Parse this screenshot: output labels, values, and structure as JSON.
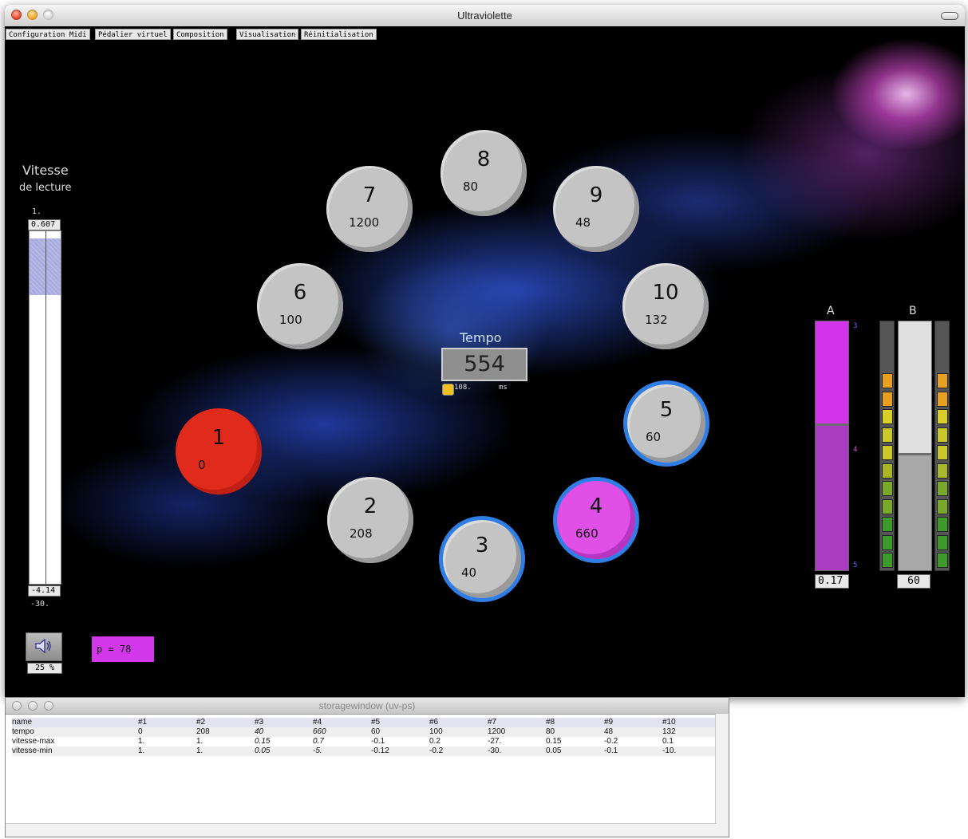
{
  "window": {
    "title": "Ultraviolette"
  },
  "menu": [
    "Configuration Midi",
    "Pédalier virtuel",
    "Composition",
    "Visualisation",
    "Réinitialisation"
  ],
  "vitesse": {
    "title": "Vitesse",
    "subtitle": "de lecture",
    "top_label": "1.",
    "value_top": "0.607",
    "value_bottom": "-4.14",
    "bottom_label": "-30.",
    "fill_fraction_from": 0.02,
    "fill_fraction_to": 0.18
  },
  "circles": [
    {
      "num": "1",
      "value": "0",
      "style": "red"
    },
    {
      "num": "2",
      "value": "208",
      "style": "gray"
    },
    {
      "num": "3",
      "value": "40",
      "style": "ring"
    },
    {
      "num": "4",
      "value": "660",
      "style": "magenta-ring"
    },
    {
      "num": "5",
      "value": "60",
      "style": "ring"
    },
    {
      "num": "6",
      "value": "100",
      "style": "gray"
    },
    {
      "num": "7",
      "value": "1200",
      "style": "gray"
    },
    {
      "num": "8",
      "value": "80",
      "style": "gray"
    },
    {
      "num": "9",
      "value": "48",
      "style": "gray"
    },
    {
      "num": "10",
      "value": "132",
      "style": "gray"
    }
  ],
  "tempo": {
    "label": "Tempo",
    "value": "554",
    "sub_value": "108.",
    "unit": "ms"
  },
  "meterA": {
    "label": "A",
    "value": "0.17",
    "tick_top": "3",
    "tick_mid": "4",
    "tick_bottom": "5",
    "level_fraction": 0.59
  },
  "meterB": {
    "label": "B",
    "value": "60",
    "level_fraction": 0.47
  },
  "volume": {
    "value": "25",
    "unit": "%"
  },
  "p_display": "p = 78",
  "colors": {
    "accent_magenta": "#d238ea",
    "ring_blue": "#2f7ee6",
    "red": "#e02a1c"
  },
  "storage": {
    "title": "storagewindow (uv-ps)",
    "columns": [
      "name",
      "#1",
      "#2",
      "#3",
      "#4",
      "#5",
      "#6",
      "#7",
      "#8",
      "#9",
      "#10"
    ],
    "rows": [
      [
        "tempo",
        "0",
        "208",
        "40",
        "660",
        "60",
        "100",
        "1200",
        "80",
        "48",
        "132"
      ],
      [
        "vitesse-max",
        "1.",
        "1.",
        "0.15",
        "0.7",
        "-0.1",
        "0.2",
        "-27.",
        "0.15",
        "-0.2",
        "0.1"
      ],
      [
        "vitesse-min",
        "1.",
        "1.",
        "0.05",
        "-5.",
        "-0.12",
        "-0.2",
        "-30.",
        "0.05",
        "-0.1",
        "-10."
      ]
    ]
  }
}
